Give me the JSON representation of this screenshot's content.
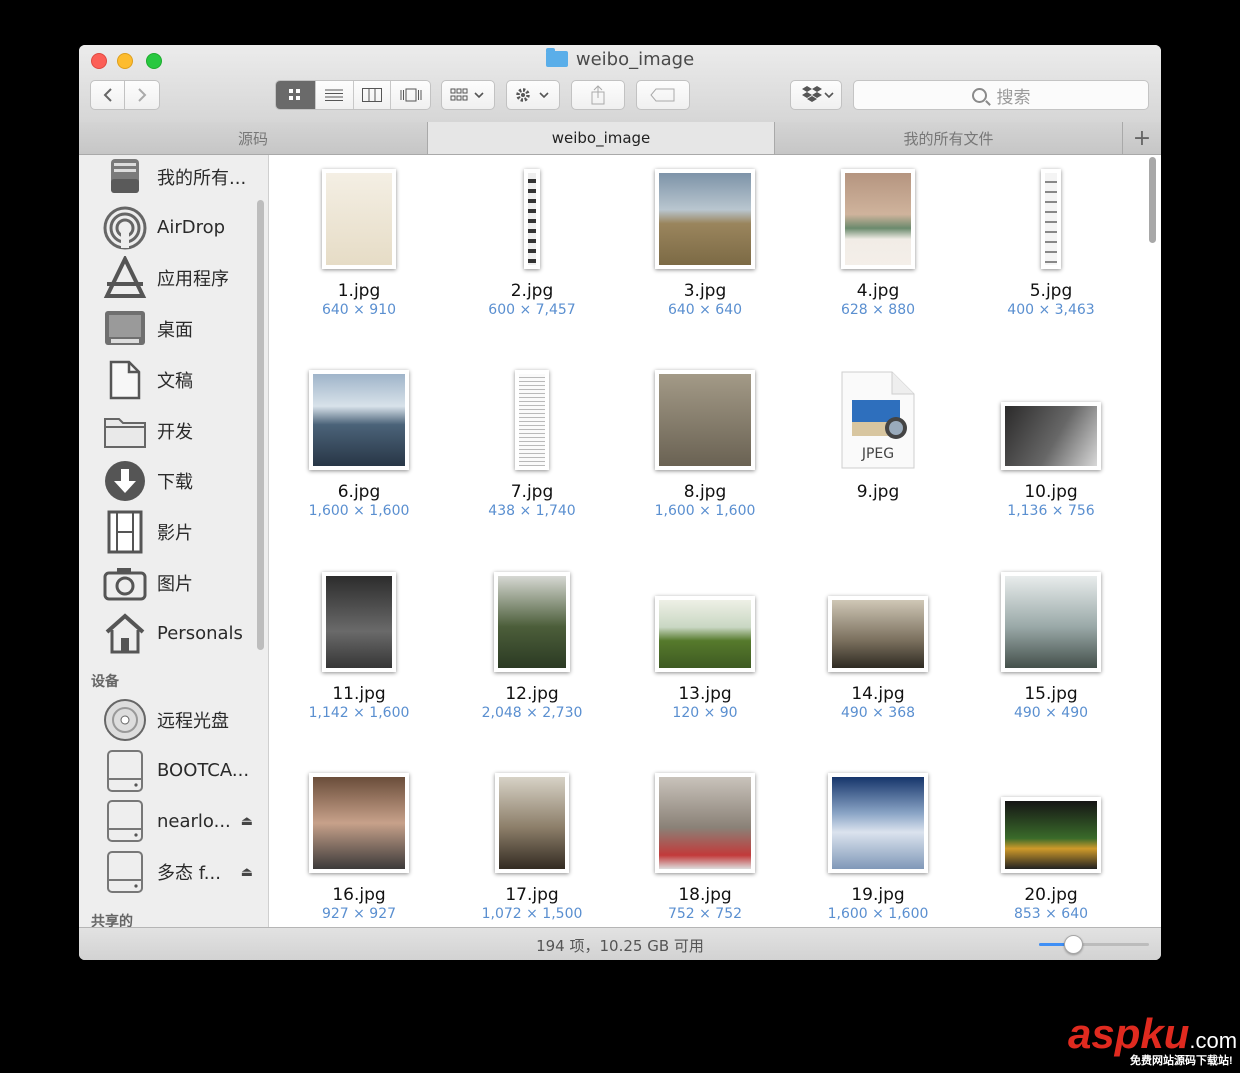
{
  "window": {
    "title": "weibo_image",
    "folder_icon": "folder-icon"
  },
  "toolbar": {
    "back": "back-arrow-icon",
    "forward": "forward-arrow-icon",
    "view_modes": [
      "icon-view",
      "list-view",
      "column-view",
      "coverflow-view"
    ],
    "active_view": "icon-view",
    "search_placeholder": "搜索"
  },
  "tabs": [
    {
      "label": "源码",
      "active": false
    },
    {
      "label": "weibo_image",
      "active": true
    },
    {
      "label": "我的所有文件",
      "active": false
    }
  ],
  "sidebar": {
    "favorites": [
      {
        "label": "我的所有...",
        "icon": "all-files-icon"
      },
      {
        "label": "AirDrop",
        "icon": "airdrop-icon"
      },
      {
        "label": "应用程序",
        "icon": "applications-icon"
      },
      {
        "label": "桌面",
        "icon": "desktop-icon"
      },
      {
        "label": "文稿",
        "icon": "documents-icon"
      },
      {
        "label": "开发",
        "icon": "folder-icon"
      },
      {
        "label": "下载",
        "icon": "download-icon"
      },
      {
        "label": "影片",
        "icon": "movies-icon"
      },
      {
        "label": "图片",
        "icon": "camera-icon"
      },
      {
        "label": "Personals",
        "icon": "home-icon"
      }
    ],
    "devices_heading": "设备",
    "devices": [
      {
        "label": "远程光盘",
        "icon": "disc-icon",
        "eject": false
      },
      {
        "label": "BOOTCA...",
        "icon": "drive-icon",
        "eject": false
      },
      {
        "label": "nearlo...",
        "icon": "drive-icon",
        "eject": true
      },
      {
        "label": "多态 f...",
        "icon": "drive-icon",
        "eject": true
      }
    ],
    "shared_heading": "共享的",
    "eject_glyph": "⏏"
  },
  "files": [
    {
      "name": "1.jpg",
      "dims": "640 × 910"
    },
    {
      "name": "2.jpg",
      "dims": "600 × 7,457"
    },
    {
      "name": "3.jpg",
      "dims": "640 × 640"
    },
    {
      "name": "4.jpg",
      "dims": "628 × 880"
    },
    {
      "name": "5.jpg",
      "dims": "400 × 3,463"
    },
    {
      "name": "6.jpg",
      "dims": "1,600 × 1,600"
    },
    {
      "name": "7.jpg",
      "dims": "438 × 1,740"
    },
    {
      "name": "8.jpg",
      "dims": "1,600 × 1,600"
    },
    {
      "name": "9.jpg",
      "dims": "",
      "generic_label": "JPEG"
    },
    {
      "name": "10.jpg",
      "dims": "1,136 × 756"
    },
    {
      "name": "11.jpg",
      "dims": "1,142 × 1,600"
    },
    {
      "name": "12.jpg",
      "dims": "2,048 × 2,730"
    },
    {
      "name": "13.jpg",
      "dims": "120 × 90"
    },
    {
      "name": "14.jpg",
      "dims": "490 × 368"
    },
    {
      "name": "15.jpg",
      "dims": "490 × 490"
    },
    {
      "name": "16.jpg",
      "dims": "927 × 927"
    },
    {
      "name": "17.jpg",
      "dims": "1,072 × 1,500"
    },
    {
      "name": "18.jpg",
      "dims": "752 × 752"
    },
    {
      "name": "19.jpg",
      "dims": "1,600 × 1,600"
    },
    {
      "name": "20.jpg",
      "dims": "853 × 640"
    }
  ],
  "status": {
    "text": "194 项，10.25 GB 可用",
    "icon_size_fraction": 0.3
  },
  "watermark": {
    "brand": "aspku",
    "suffix": ".com",
    "tagline": "免费网站源码下载站!"
  }
}
